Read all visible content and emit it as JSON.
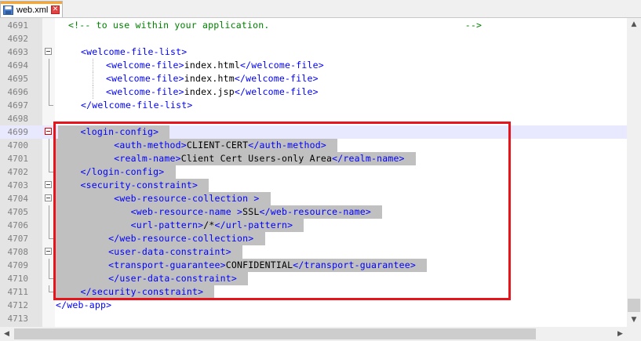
{
  "tab": {
    "title": "web.xml",
    "icon": "save-disk-icon",
    "close_icon": "close-icon",
    "accent_color": "#f9a532"
  },
  "editor": {
    "current_line": 4699,
    "selection_color": "#c0c0c0",
    "highlight_box_color": "#e8141b",
    "lines": [
      {
        "num": "4691",
        "segments": [
          [
            "c",
            "<!-- to use within your application.                                   -->"
          ]
        ]
      },
      {
        "num": "4692",
        "segments": []
      },
      {
        "num": "4693",
        "segments": [
          [
            "t",
            "<welcome-file-list>"
          ]
        ]
      },
      {
        "num": "4694",
        "segments": [
          [
            "t",
            "<welcome-file>"
          ],
          [
            "x",
            "index.html"
          ],
          [
            "t",
            "</welcome-file>"
          ]
        ]
      },
      {
        "num": "4695",
        "segments": [
          [
            "t",
            "<welcome-file>"
          ],
          [
            "x",
            "index.htm"
          ],
          [
            "t",
            "</welcome-file>"
          ]
        ]
      },
      {
        "num": "4696",
        "segments": [
          [
            "t",
            "<welcome-file>"
          ],
          [
            "x",
            "index.jsp"
          ],
          [
            "t",
            "</welcome-file>"
          ]
        ]
      },
      {
        "num": "4697",
        "segments": [
          [
            "t",
            "</welcome-file-list>"
          ]
        ]
      },
      {
        "num": "4698",
        "segments": []
      },
      {
        "num": "4699",
        "segments": [
          [
            "t",
            "<login-config>"
          ]
        ]
      },
      {
        "num": "4700",
        "segments": [
          [
            "t",
            "<auth-method>"
          ],
          [
            "x",
            "CLIENT-CERT"
          ],
          [
            "t",
            "</auth-method>"
          ]
        ]
      },
      {
        "num": "4701",
        "segments": [
          [
            "t",
            "<realm-name>"
          ],
          [
            "x",
            "Client Cert Users-only Area"
          ],
          [
            "t",
            "</realm-name>"
          ]
        ]
      },
      {
        "num": "4702",
        "segments": [
          [
            "t",
            "</login-config>"
          ]
        ]
      },
      {
        "num": "4703",
        "segments": [
          [
            "t",
            "<security-constraint>"
          ]
        ]
      },
      {
        "num": "4704",
        "segments": [
          [
            "t",
            "<web-resource-collection >"
          ]
        ]
      },
      {
        "num": "4705",
        "segments": [
          [
            "t",
            "<web-resource-name >"
          ],
          [
            "x",
            "SSL"
          ],
          [
            "t",
            "</web-resource-name>"
          ]
        ]
      },
      {
        "num": "4706",
        "segments": [
          [
            "t",
            "<url-pattern>"
          ],
          [
            "x",
            "/*"
          ],
          [
            "t",
            "</url-pattern>"
          ]
        ]
      },
      {
        "num": "4707",
        "segments": [
          [
            "t",
            "</web-resource-collection>"
          ]
        ]
      },
      {
        "num": "4708",
        "segments": [
          [
            "t",
            "<user-data-constraint>"
          ]
        ]
      },
      {
        "num": "4709",
        "segments": [
          [
            "t",
            "<transport-guarantee>"
          ],
          [
            "x",
            "CONFIDENTIAL"
          ],
          [
            "t",
            "</transport-guarantee>"
          ]
        ]
      },
      {
        "num": "4710",
        "segments": [
          [
            "t",
            "</user-data-constraint>"
          ]
        ]
      },
      {
        "num": "4711",
        "segments": [
          [
            "t",
            "</security-constraint>"
          ]
        ]
      },
      {
        "num": "4712",
        "segments": [
          [
            "t",
            "</web-app>"
          ]
        ]
      },
      {
        "num": "4713",
        "segments": []
      }
    ]
  },
  "scrollbars": {
    "up_icon": "arrow-up-icon",
    "down_icon": "arrow-down-icon",
    "left_icon": "arrow-left-icon",
    "right_icon": "arrow-right-icon"
  }
}
